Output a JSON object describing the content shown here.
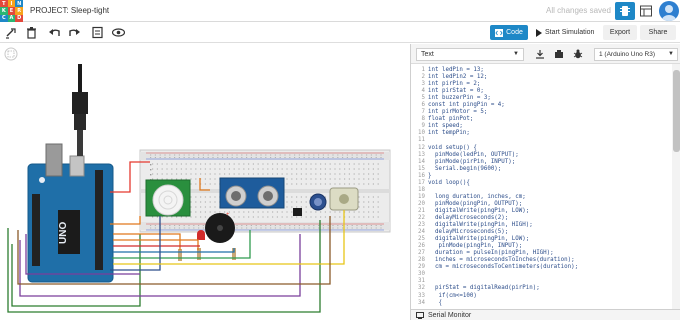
{
  "logo": {
    "letters": [
      "TIN",
      "KER",
      "CAD"
    ]
  },
  "project": {
    "title": "PROJECT: Sleep-tight",
    "save_status": "All changes saved"
  },
  "toolbar": {
    "code_label": "Code",
    "simulation_label": "Start Simulation",
    "export_label": "Export",
    "share_label": "Share"
  },
  "code_panel": {
    "mode": "Text",
    "board": "1 (Arduino Uno R3)",
    "serial_monitor_label": "Serial Monitor",
    "lines": [
      "int ledPin = 13;",
      "int ledPin2 = 12;",
      "int pirPin = 2;",
      "int pirStat = 0;",
      "int buzzerPin = 3;",
      "const int pingPin = 4;",
      "int pirMotor = 5;",
      "float pinPot;",
      "int speed;",
      "int tempPin;",
      "",
      "void setup() {",
      "  pinMode(ledPin, OUTPUT);",
      "  pinMode(pirPin, INPUT);",
      "  Serial.begin(9600);",
      "}",
      "void loop(){",
      "",
      "  long duration, inches, cm;",
      "  pinMode(pingPin, OUTPUT);",
      "  digitalWrite(pingPin, LOW);",
      "  delayMicroseconds(2);",
      "  digitalWrite(pingPin, HIGH);",
      "  delayMicroseconds(5);",
      "  digitalWrite(pingPin, LOW);",
      "   pinMode(pingPin, INPUT);",
      "  duration = pulseIn(pingPin, HIGH);",
      "  inches = microsecondsToInches(duration);",
      "  cm = microsecondsToCentimeters(duration);",
      "",
      "",
      "  pirStat = digitalRead(pirPin);",
      "   if(cm<=100)",
      "   {"
    ]
  }
}
